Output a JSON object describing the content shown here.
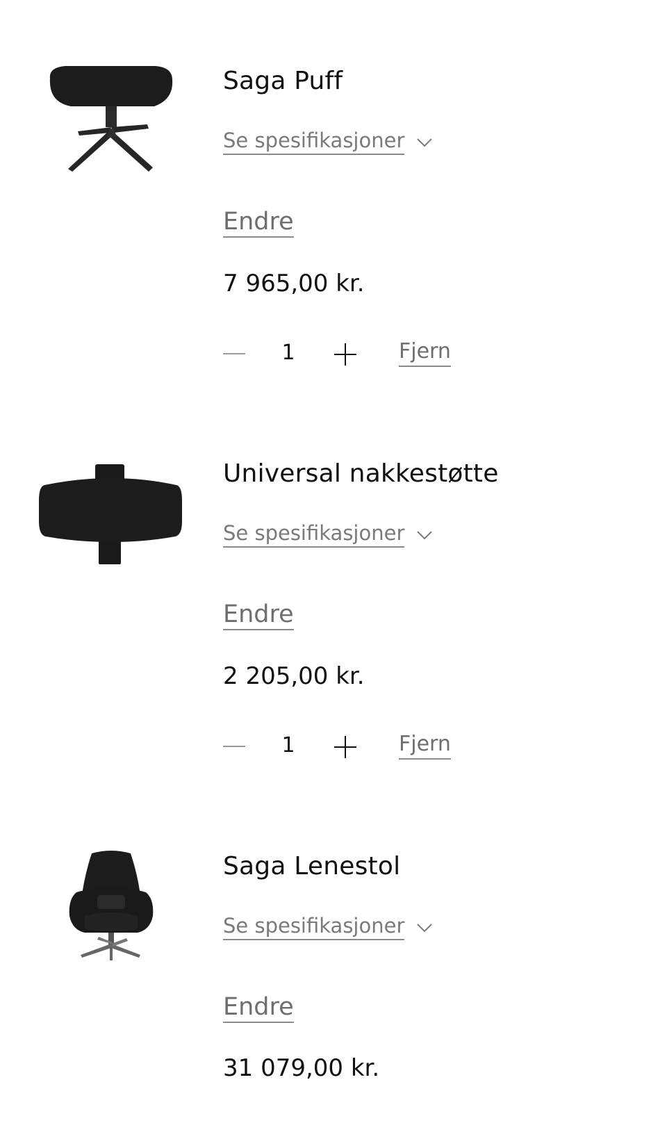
{
  "cart": {
    "items": [
      {
        "name": "Saga Puff",
        "image_icon": "ottoman-icon",
        "spec_label": "Se spesifikasjoner",
        "edit_label": "Endre",
        "price": "7 965,00 kr.",
        "quantity": "1",
        "remove_label": "Fjern"
      },
      {
        "name": "Universal nakkestøtte",
        "image_icon": "headrest-icon",
        "spec_label": "Se spesifikasjoner",
        "edit_label": "Endre",
        "price": "2 205,00 kr.",
        "quantity": "1",
        "remove_label": "Fjern"
      },
      {
        "name": "Saga Lenestol",
        "image_icon": "armchair-icon",
        "spec_label": "Se spesifikasjoner",
        "edit_label": "Endre",
        "price": "31 079,00 kr."
      }
    ]
  },
  "colors": {
    "text": "#111111",
    "muted_link": "#7a7a7a",
    "product_black": "#1c1c1c"
  }
}
